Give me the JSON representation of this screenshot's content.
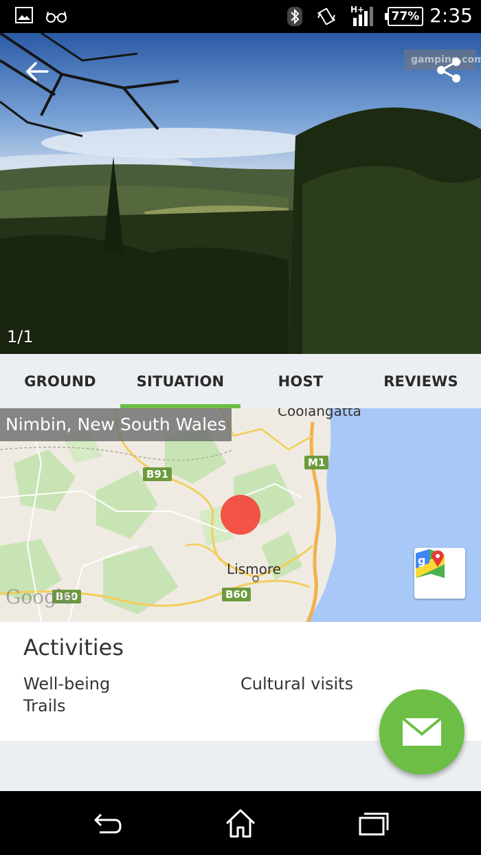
{
  "status_bar": {
    "time": "2:35",
    "battery": "77%",
    "network": "H+",
    "icons": [
      "gallery-icon",
      "glasses-icon",
      "bluetooth-icon",
      "vibrate-icon",
      "signal-icon",
      "battery-icon"
    ]
  },
  "header": {
    "photo_counter": "1/1",
    "watermark": "gamping.com",
    "icons": [
      "back-arrow-icon",
      "share-icon"
    ]
  },
  "tabs": [
    {
      "label": "GROUND",
      "active": false
    },
    {
      "label": "SITUATION",
      "active": true
    },
    {
      "label": "HOST",
      "active": false
    },
    {
      "label": "REVIEWS",
      "active": false
    }
  ],
  "map": {
    "location": "Nimbin, New South Wales",
    "towns": [
      "Coolangatta",
      "Lismore"
    ],
    "roads": [
      "B91",
      "M1",
      "B60",
      "B60"
    ],
    "attribution": "Google",
    "maps_button_icon": "google-maps-icon"
  },
  "activities": {
    "title": "Activities",
    "items": [
      "Well-being",
      "Cultural visits",
      "Trails"
    ]
  },
  "fab": {
    "icon": "envelope-icon"
  },
  "nav_bar": {
    "icons": [
      "nav-back-icon",
      "nav-home-icon",
      "nav-recents-icon"
    ]
  },
  "colors": {
    "accent": "#6cbe45",
    "tab_bg": "#eceff1",
    "map_sea": "#a8c8f8",
    "pin": "#f44336"
  }
}
